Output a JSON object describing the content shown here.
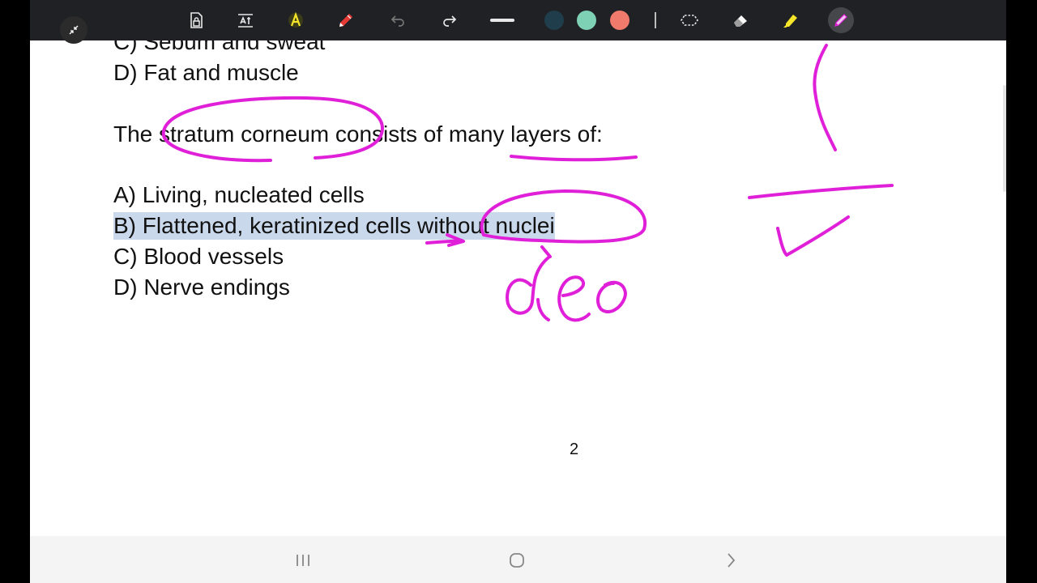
{
  "toolbar": {
    "tools": [
      {
        "name": "lock-icon"
      },
      {
        "name": "text-icon"
      },
      {
        "name": "pen-a-icon"
      },
      {
        "name": "pencil-icon"
      },
      {
        "name": "undo-icon"
      },
      {
        "name": "redo-icon"
      },
      {
        "name": "line-width-icon"
      },
      {
        "name": "lasso-icon"
      },
      {
        "name": "eraser-icon"
      },
      {
        "name": "highlighter-icon"
      },
      {
        "name": "pen-icon"
      }
    ],
    "colors": [
      "#1f3d4a",
      "#7fd1b5",
      "#f07b6d"
    ]
  },
  "document": {
    "prev_option_c": "C) Sebum and sweat",
    "prev_option_d": "D) Fat and muscle",
    "question": "The stratum corneum consists of many layers of:",
    "options": {
      "a": "A) Living, nucleated cells",
      "b": "B) Flattened, keratinized cells without nuclei",
      "c": "C) Blood vessels",
      "d": "D) Nerve endings"
    },
    "page_number": "2"
  },
  "ink": {
    "color": "#e020d8"
  },
  "navbar": {
    "items": [
      {
        "name": "recent-apps-icon"
      },
      {
        "name": "home-icon"
      },
      {
        "name": "back-icon"
      }
    ]
  }
}
